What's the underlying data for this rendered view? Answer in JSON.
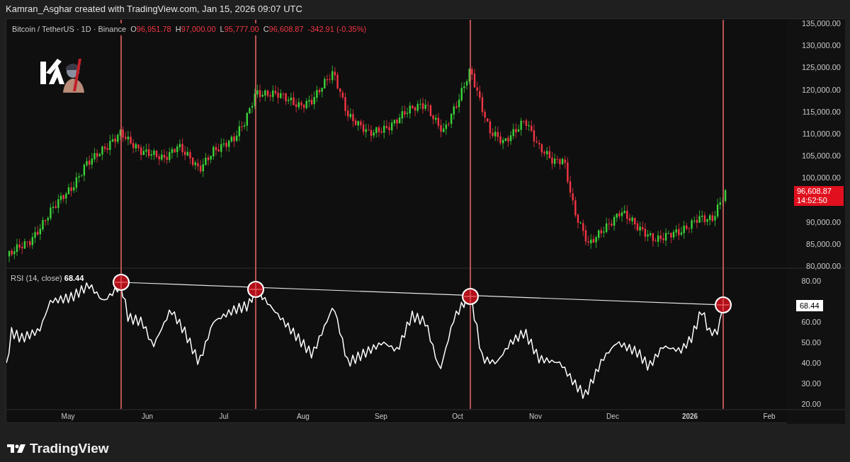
{
  "header": {
    "text": "Kamran_Asghar created with TradingView.com, Jan 15, 2026 09:07 UTC"
  },
  "legend": {
    "symbol": "Bitcoin / TetherUS · 1D · Binance",
    "falling": true,
    "ohlc": [
      {
        "label": "O",
        "value": "96,951.78"
      },
      {
        "label": "H",
        "value": "97,000.00"
      },
      {
        "label": "L",
        "value": "95,777.00"
      },
      {
        "label": "C",
        "value": "96,608.87"
      }
    ],
    "change": "-342.91 (-0.35%)"
  },
  "price_axis": [
    "135,000.00",
    "130,000.00",
    "125,000.00",
    "120,000.00",
    "115,000.00",
    "110,000.00",
    "105,000.00",
    "100,000.00",
    "90,000.00",
    "85,000.00",
    "80,000.00"
  ],
  "price_badge": {
    "price": "96,608.87",
    "countdown": "14:52:50",
    "falling": true
  },
  "rsi": {
    "title": "RSI (14, close)",
    "value": "68.44",
    "axis": [
      "80.00",
      "60.00",
      "50.00",
      "40.00",
      "30.00",
      "20.00"
    ],
    "badge": "68.44"
  },
  "time_axis": [
    {
      "label": "May",
      "kind": "month"
    },
    {
      "label": "Jun",
      "kind": "month"
    },
    {
      "label": "Jul",
      "kind": "month"
    },
    {
      "label": "Aug",
      "kind": "month"
    },
    {
      "label": "Sep",
      "kind": "month"
    },
    {
      "label": "Oct",
      "kind": "month"
    },
    {
      "label": "Nov",
      "kind": "month"
    },
    {
      "label": "Dec",
      "kind": "month"
    },
    {
      "label": "2026",
      "kind": "year"
    },
    {
      "label": "Feb",
      "kind": "month"
    }
  ],
  "footer": {
    "brand": "TradingView"
  }
}
